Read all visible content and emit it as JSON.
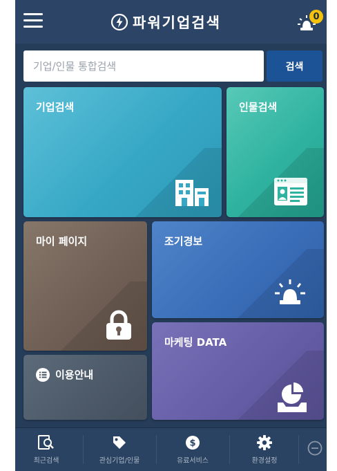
{
  "header": {
    "title": "파워기업검색",
    "alarm_count": "0"
  },
  "search": {
    "placeholder": "기업/인물 통합검색",
    "value": "",
    "button_label": "검색"
  },
  "tiles": {
    "company": {
      "label": "기업검색",
      "icon": "building-icon",
      "color": "#36a8c6"
    },
    "person": {
      "label": "인물검색",
      "icon": "id-card-icon",
      "color": "#2fb3a0"
    },
    "mypage": {
      "label": "마이 페이지",
      "icon": "lock-icon",
      "color": "#6f5e53"
    },
    "alert": {
      "label": "조기경보",
      "icon": "siren-icon",
      "color": "#3a6eb8"
    },
    "guide": {
      "label": "이용안내",
      "icon": "list-icon",
      "color": "#4c5968"
    },
    "marketing": {
      "label": "마케팅 DATA",
      "icon": "chart-tray-icon",
      "color": "#665ea6"
    }
  },
  "bottom_nav": {
    "items": [
      {
        "label": "최근검색",
        "icon": "recent-search-icon"
      },
      {
        "label": "관심기업/인물",
        "icon": "tag-icon"
      },
      {
        "label": "유료서비스",
        "icon": "dollar-icon"
      },
      {
        "label": "환경설정",
        "icon": "gear-icon"
      }
    ],
    "collapse_icon": "minus-circle-icon"
  },
  "colors": {
    "background": "#263d5a",
    "header": "#2c4566",
    "search_button": "#1c5296",
    "badge": "#f4c20d"
  }
}
